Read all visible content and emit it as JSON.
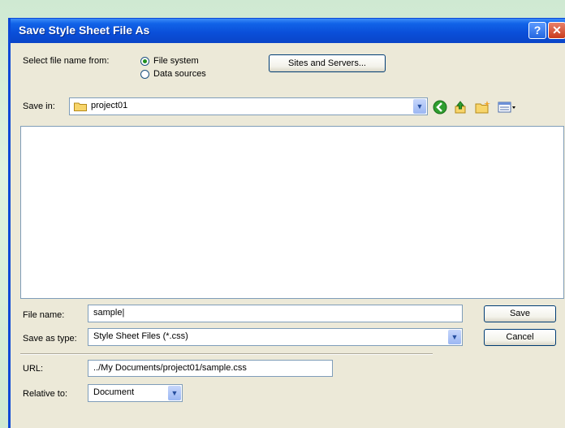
{
  "dialog": {
    "title": "Save Style Sheet File As",
    "help_label": "?",
    "close_label": "✕"
  },
  "select_from": {
    "label": "Select file name from:",
    "options": [
      "File system",
      "Data sources"
    ],
    "selected": "File system"
  },
  "sites_button": "Sites and Servers...",
  "save_in": {
    "label": "Save in:",
    "value": "project01"
  },
  "file_name": {
    "label": "File name:",
    "value": "sample|"
  },
  "save_as_type": {
    "label": "Save as type:",
    "value": "Style Sheet Files (*.css)"
  },
  "buttons": {
    "save": "Save",
    "cancel": "Cancel"
  },
  "url": {
    "label": "URL:",
    "value": "../My Documents/project01/sample.css"
  },
  "relative_to": {
    "label": "Relative to:",
    "value": "Document"
  },
  "icons": {
    "back": "green-back-arrow-icon",
    "up": "up-folder-icon",
    "new_folder": "new-folder-icon",
    "view": "view-menu-icon"
  }
}
